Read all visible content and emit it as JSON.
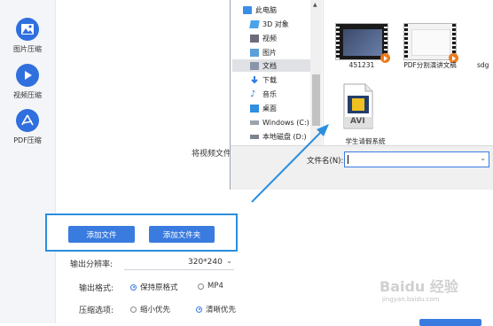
{
  "sidebar": {
    "items": [
      {
        "label": "图片压缩",
        "icon": "image-icon"
      },
      {
        "label": "视频压缩",
        "icon": "play-icon"
      },
      {
        "label": "PDF压缩",
        "icon": "pdf-icon"
      }
    ]
  },
  "main": {
    "drop_hint": "将视频文件",
    "buttons": {
      "add_file": "添加文件",
      "add_folder": "添加文件夹"
    },
    "resolution": {
      "label": "输出分辨率:",
      "value": "320*240"
    },
    "format": {
      "label": "输出格式:",
      "options": [
        "保持原格式",
        "MP4"
      ],
      "selected": "保持原格式"
    },
    "compress": {
      "label": "压缩选项:",
      "options": [
        "缩小优先",
        "清晰优先"
      ],
      "selected": "清晰优先"
    }
  },
  "dialog": {
    "tree": [
      {
        "label": "此电脑",
        "icon": "pc-icon"
      },
      {
        "label": "3D 对象",
        "icon": "3d-objects-icon"
      },
      {
        "label": "视频",
        "icon": "video-folder-icon"
      },
      {
        "label": "图片",
        "icon": "pictures-folder-icon"
      },
      {
        "label": "文档",
        "icon": "documents-folder-icon"
      },
      {
        "label": "下载",
        "icon": "download-icon"
      },
      {
        "label": "音乐",
        "icon": "music-icon"
      },
      {
        "label": "桌面",
        "icon": "desktop-icon"
      },
      {
        "label": "Windows (C:)",
        "icon": "drive-icon"
      },
      {
        "label": "本地磁盘 (D:)",
        "icon": "drive-icon"
      }
    ],
    "selected_tree_item": "文档",
    "files": [
      {
        "name": "451231",
        "type": "video"
      },
      {
        "name": "PDF分割演讲文稿",
        "type": "video"
      },
      {
        "name": "sdg",
        "type": "video"
      },
      {
        "name": "学生请假系统",
        "type": "avi"
      }
    ],
    "avi_label": "AVI",
    "filename_label": "文件名(N):",
    "filename_value": ""
  },
  "watermark": {
    "text": "Baidu 经验",
    "sub": "jingyan.baidu.com"
  },
  "colors": {
    "accent": "#3a7be0",
    "highlight_border": "#2c8fde",
    "annotation_arrow": "#2c8fde"
  }
}
